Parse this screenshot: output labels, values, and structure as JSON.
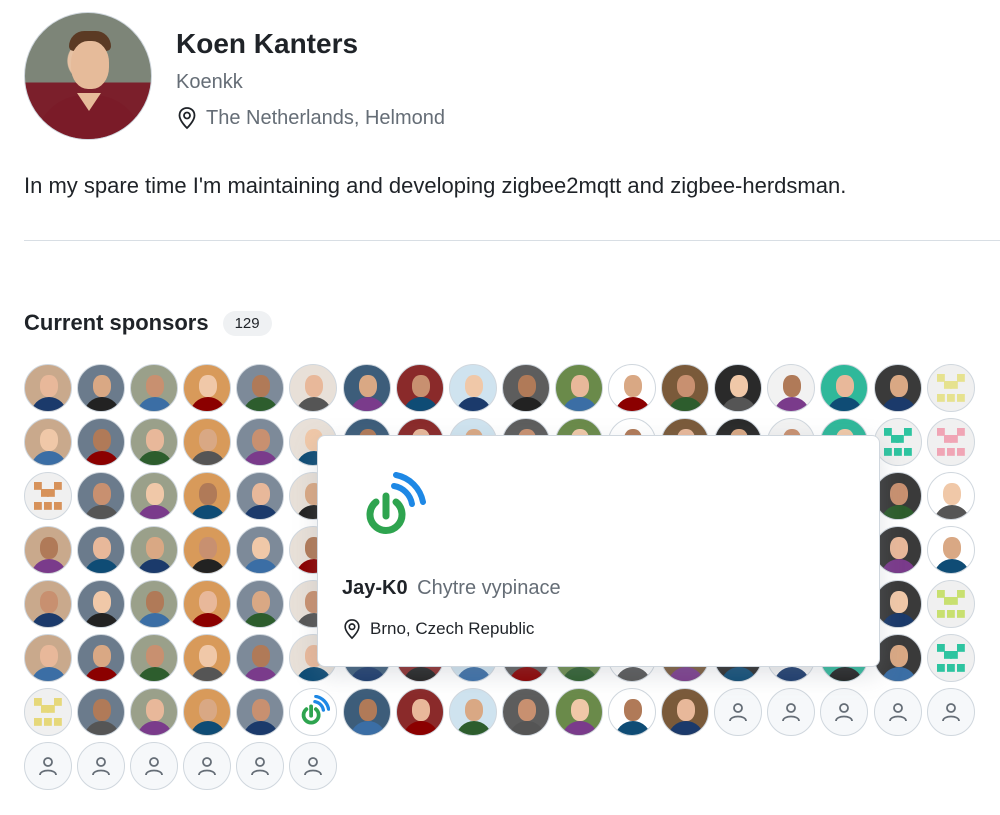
{
  "profile": {
    "name": "Koen Kanters",
    "login": "Koenkk",
    "location": "The Netherlands, Helmond",
    "bio": "In my spare time I'm maintaining and developing zigbee2mqtt and zigbee-herdsman."
  },
  "sponsors": {
    "title": "Current sponsors",
    "count": "129"
  },
  "hovercard": {
    "login": "Jay-K0",
    "name": "Chytre vypinace",
    "location": "Brno, Czech Republic"
  },
  "colors": {
    "accent_green": "#2ea44f",
    "accent_blue": "#1e88e5",
    "muted_text": "#656d76"
  },
  "icons": {
    "location": "location-pin-icon",
    "placeholder": "person-icon",
    "sponsor_logo": "power-wifi-icon"
  }
}
